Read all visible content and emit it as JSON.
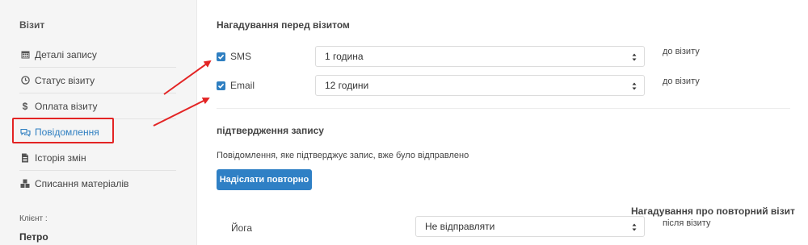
{
  "sidebar": {
    "title": "Візит",
    "items": [
      {
        "label": "Деталі запису",
        "icon": "calendar-icon"
      },
      {
        "label": "Статус візиту",
        "icon": "clock-icon"
      },
      {
        "label": "Оплата візиту",
        "icon": "dollar-icon"
      },
      {
        "label": "Повідомлення",
        "icon": "chat-icon"
      },
      {
        "label": "Історія змін",
        "icon": "document-icon"
      },
      {
        "label": "Списання матеріалів",
        "icon": "cubes-icon"
      }
    ],
    "client_label": "Клієнт :",
    "client_name": "Петро"
  },
  "reminder": {
    "title": "Нагадування перед візитом",
    "sms": {
      "label": "SMS",
      "checked": true,
      "value": "1 година",
      "suffix": "до візиту"
    },
    "email": {
      "label": "Email",
      "checked": true,
      "value": "12 години",
      "suffix": "до візиту"
    }
  },
  "confirmation": {
    "title": "підтвердження запису",
    "message": "Повідомлення, яке підтверджує запис, вже було відправлено",
    "resend_button": "Надіслати повторно"
  },
  "repeat": {
    "title": "Нагадування про повторний візит",
    "service": "Йога",
    "value": "Не відправляти",
    "suffix": "після візиту"
  },
  "colors": {
    "accent": "#2f7fc1",
    "annotation": "#e32424"
  }
}
